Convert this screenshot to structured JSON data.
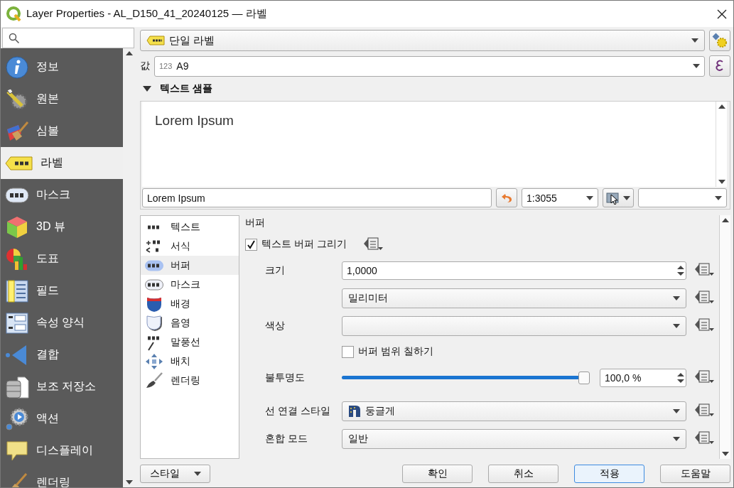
{
  "window": {
    "title": "Layer Properties - AL_D150_41_20240125 — 라벨"
  },
  "sidebar": {
    "items": [
      {
        "label": "정보",
        "selected": false
      },
      {
        "label": "원본",
        "selected": false
      },
      {
        "label": "심볼",
        "selected": false
      },
      {
        "label": "라벨",
        "selected": true
      },
      {
        "label": "마스크",
        "selected": false
      },
      {
        "label": "3D 뷰",
        "selected": false
      },
      {
        "label": "도표",
        "selected": false
      },
      {
        "label": "필드",
        "selected": false
      },
      {
        "label": "속성 양식",
        "selected": false
      },
      {
        "label": "결합",
        "selected": false
      },
      {
        "label": "보조 저장소",
        "selected": false
      },
      {
        "label": "액션",
        "selected": false
      },
      {
        "label": "디스플레이",
        "selected": false
      },
      {
        "label": "렌더링",
        "selected": false
      }
    ]
  },
  "mode_combo": {
    "value": "단일 라벨"
  },
  "value_field": {
    "label": "값",
    "type_hint": "123",
    "value": "A9"
  },
  "text_sample": {
    "title": "텍스트 샘플",
    "expanded": true,
    "preview": "Lorem Ipsum",
    "input": "Lorem Ipsum",
    "scale": "1:3055"
  },
  "sections": [
    {
      "label": "텍스트",
      "selected": false
    },
    {
      "label": "서식",
      "selected": false
    },
    {
      "label": "버퍼",
      "selected": true
    },
    {
      "label": "마스크",
      "selected": false
    },
    {
      "label": "배경",
      "selected": false
    },
    {
      "label": "음영",
      "selected": false
    },
    {
      "label": "말풍선",
      "selected": false
    },
    {
      "label": "배치",
      "selected": false
    },
    {
      "label": "렌더링",
      "selected": false
    }
  ],
  "buffer": {
    "title": "버퍼",
    "draw_buffer": {
      "label": "텍스트 버퍼 그리기",
      "checked": true
    },
    "size": {
      "label": "크기",
      "value": "1,0000"
    },
    "unit": {
      "value": "밀리미터"
    },
    "color": {
      "label": "색상"
    },
    "fill_buffer": {
      "label": "버퍼 범위 칠하기",
      "checked": false
    },
    "opacity": {
      "label": "불투명도",
      "level": 1,
      "value": "100,0 %"
    },
    "join_style": {
      "label": "선 연결 스타일",
      "value": "둥글게"
    },
    "blend_mode": {
      "label": "혼합 모드",
      "value": "일반"
    }
  },
  "style_button": {
    "label": "스타일"
  },
  "buttons": [
    {
      "label": "확인",
      "focused": false
    },
    {
      "label": "취소",
      "focused": false
    },
    {
      "label": "적용",
      "focused": true
    },
    {
      "label": "도움말",
      "focused": false
    }
  ]
}
